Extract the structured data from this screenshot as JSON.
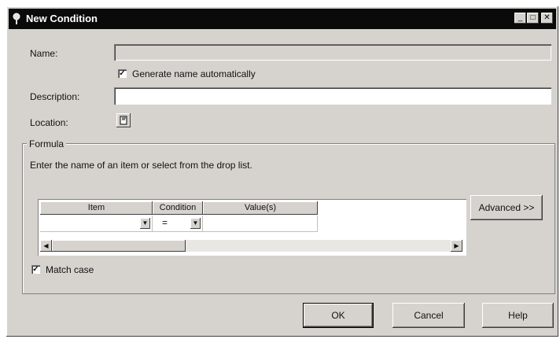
{
  "window": {
    "title": "New Condition",
    "min_glyph": "_",
    "max_glyph": "□",
    "close_glyph": "✕"
  },
  "fields": {
    "name_label": "Name:",
    "name_value": "",
    "generate_label": "Generate name automatically",
    "generate_checked": true,
    "description_label": "Description:",
    "description_value": "",
    "location_label": "Location:"
  },
  "formula": {
    "group_label": "Formula",
    "hint": "Enter the name of an item or select from the drop list.",
    "columns": [
      "Item",
      "Condition",
      "Value(s)"
    ],
    "row": {
      "item": "",
      "condition": "=",
      "values": ""
    },
    "advanced_label": "Advanced >>",
    "match_case_label": "Match case",
    "match_case_checked": true
  },
  "buttons": {
    "ok": "OK",
    "cancel": "Cancel",
    "help": "Help"
  },
  "icons": {
    "title": "pin-icon",
    "location": "location-icon"
  }
}
